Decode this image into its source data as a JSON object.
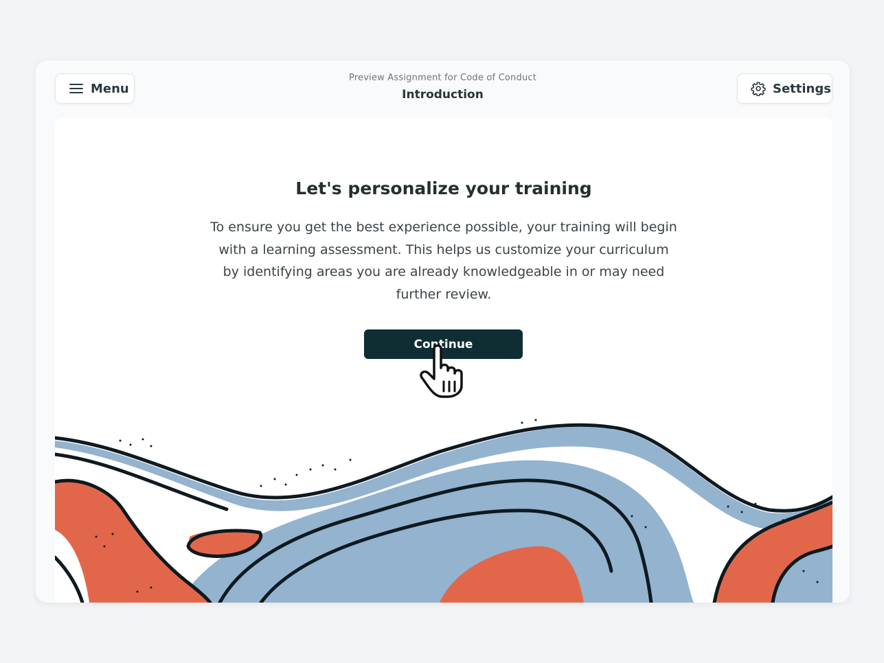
{
  "header": {
    "subtitle": "Preview Assignment for Code of Conduct",
    "title": "Introduction",
    "menu_label": "Menu",
    "settings_label": "Settings"
  },
  "content": {
    "title": "Let's personalize your training",
    "body": "To ensure you get the best experience possible, your training will begin with a learning assessment. This helps us customize your curriculum by identifying areas you are already knowledgeable in or may need further review.",
    "continue_label": "Continue"
  },
  "icons": {
    "menu": "hamburger-menu-icon",
    "settings": "gear-icon",
    "cursor": "hand-pointer-cursor-icon"
  },
  "colors": {
    "button_bg": "#0f2e34",
    "wave_blue": "#93b3cf",
    "wave_orange": "#e2674a",
    "outline": "#0e1a1f",
    "page_bg": "#f3f4f6"
  }
}
